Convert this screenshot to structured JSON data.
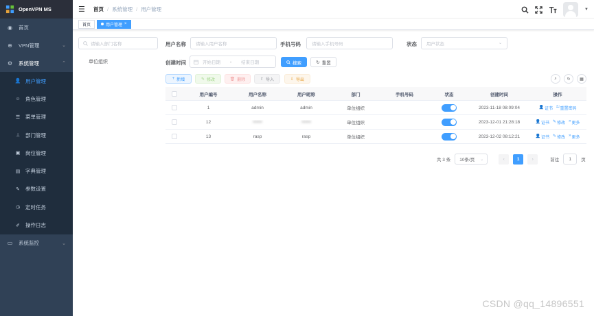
{
  "app": {
    "title": "OpenVPN MS"
  },
  "sidebar": {
    "items": [
      {
        "label": "首页",
        "icon": "dashboard-icon"
      },
      {
        "label": "VPN管理",
        "icon": "globe-icon"
      },
      {
        "label": "系统管理",
        "icon": "gear-icon"
      },
      {
        "label": "系统监控",
        "icon": "monitor-icon"
      }
    ],
    "submenu": [
      {
        "label": "用户管理",
        "icon": "user-icon"
      },
      {
        "label": "角色管理",
        "icon": "role-icon"
      },
      {
        "label": "菜单管理",
        "icon": "menu-list-icon"
      },
      {
        "label": "部门管理",
        "icon": "tree-icon"
      },
      {
        "label": "岗位管理",
        "icon": "post-icon"
      },
      {
        "label": "字典管理",
        "icon": "dict-icon"
      },
      {
        "label": "参数设置",
        "icon": "edit-icon"
      },
      {
        "label": "定时任务",
        "icon": "job-icon"
      },
      {
        "label": "操作日志",
        "icon": "log-icon"
      }
    ]
  },
  "header": {
    "breadcrumb": {
      "first": "首页",
      "second": "系统管理",
      "third": "用户管理"
    }
  },
  "tags": {
    "home": "首页",
    "current": "用户管理"
  },
  "dept": {
    "search_placeholder": "请输入部门名称",
    "root": "单位组织"
  },
  "query": {
    "username_label": "用户名称",
    "username_placeholder": "请输入用户名称",
    "phone_label": "手机号码",
    "phone_placeholder": "请输入手机号码",
    "status_label": "状态",
    "status_placeholder": "用户状态",
    "time_label": "创建时间",
    "start_placeholder": "开始日期",
    "range_sep": "-",
    "end_placeholder": "结束日期",
    "search_btn": "搜索",
    "reset_btn": "重置"
  },
  "toolbar": {
    "add": "新增",
    "edit": "修改",
    "delete": "删除",
    "import": "导入",
    "export": "导出"
  },
  "table": {
    "columns": [
      "用户编号",
      "用户名称",
      "用户昵称",
      "部门",
      "手机号码",
      "状态",
      "创建时间",
      "操作"
    ],
    "rows": [
      {
        "id": "1",
        "username": "admin",
        "nickname": "admin",
        "dept": "单位组织",
        "phone": "",
        "created": "2023-11-18 08:09:04",
        "actions": [
          "证书",
          "重置密码"
        ]
      },
      {
        "id": "12",
        "username": "••••••",
        "nickname": "••••••",
        "dept": "单位组织",
        "phone": "",
        "created": "2023-12-01 21:28:18",
        "actions": [
          "证书",
          "修改",
          "更多"
        ]
      },
      {
        "id": "13",
        "username": "rasp",
        "nickname": "rasp",
        "dept": "单位组织",
        "phone": "",
        "created": "2023-12-02 08:12:21",
        "actions": [
          "证书",
          "修改",
          "更多"
        ]
      }
    ]
  },
  "pagination": {
    "total": "共 3 条",
    "page_size": "10条/页",
    "current": "1",
    "goto_label": "前往",
    "goto_value": "1",
    "page_unit": "页"
  },
  "watermark": "CSDN @qq_14896551",
  "colors": {
    "primary": "#409eff",
    "sidebar": "#304156",
    "submenu": "#1f2d3d"
  }
}
